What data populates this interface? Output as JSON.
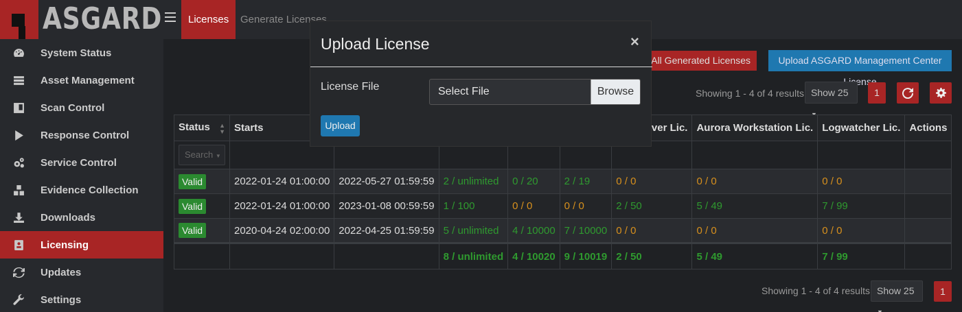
{
  "brand": {
    "name": "ASGARD"
  },
  "sidebar": {
    "items": [
      {
        "label": "System Status",
        "icon": "dashboard-icon"
      },
      {
        "label": "Asset Management",
        "icon": "server-icon"
      },
      {
        "label": "Scan Control",
        "icon": "scan-icon"
      },
      {
        "label": "Response Control",
        "icon": "play-icon"
      },
      {
        "label": "Service Control",
        "icon": "gears-icon"
      },
      {
        "label": "Evidence Collection",
        "icon": "cubes-icon"
      },
      {
        "label": "Downloads",
        "icon": "download-icon"
      },
      {
        "label": "Licensing",
        "icon": "id-card-icon",
        "active": true
      },
      {
        "label": "Updates",
        "icon": "refresh-icon"
      },
      {
        "label": "Settings",
        "icon": "wrench-icon"
      }
    ]
  },
  "topbar": {
    "tabs": [
      "Licenses",
      "Generate Licenses"
    ]
  },
  "toolbar": {
    "download_all": "ad All Generated Licenses",
    "upload_amc": "Upload ASGARD Management Center License",
    "showing": "Showing 1 - 4 of 4 results",
    "show_count": "Show 25",
    "page": "1"
  },
  "table": {
    "headers": [
      "Status",
      "Starts",
      "",
      "",
      "",
      "",
      "ora Server Lic.",
      "Aurora Workstation Lic.",
      "Logwatcher Lic.",
      "Actions"
    ],
    "search_placeholder": "Search",
    "rows": [
      {
        "status": "Valid",
        "starts": "2022-01-24 01:00:00",
        "expires": "2022-05-27 01:59:59",
        "c1": "2 / unlimited",
        "c2": "0 / 20",
        "c3": "2 / 19",
        "c4": "0 / 0",
        "c5": "0 / 0",
        "c6": "0 / 0"
      },
      {
        "status": "Valid",
        "starts": "2022-01-24 01:00:00",
        "expires": "2023-01-08 00:59:59",
        "c1": "1 / 100",
        "c2": "0 / 0",
        "c3": "0 / 0",
        "c4": "2 / 50",
        "c5": "5 / 49",
        "c6": "7 / 99"
      },
      {
        "status": "Valid",
        "starts": "2020-04-24 02:00:00",
        "expires": "2022-04-25 01:59:59",
        "c1": "5 / unlimited",
        "c2": "4 / 10000",
        "c3": "7 / 10000",
        "c4": "0 / 0",
        "c5": "0 / 0",
        "c6": "0 / 0"
      }
    ],
    "totals": {
      "c1": "8 / unlimited",
      "c2": "4 / 10020",
      "c3": "9 / 10019",
      "c4": "2 / 50",
      "c5": "5 / 49",
      "c6": "7 / 99"
    }
  },
  "footer": {
    "showing": "Showing 1 - 4 of 4 results",
    "show_count": "Show 25",
    "page": "1"
  },
  "modal": {
    "title": "Upload License",
    "close": "×",
    "field_label": "License File",
    "file_placeholder": "Select File",
    "browse": "Browse",
    "upload": "Upload"
  },
  "colors": {
    "accent_red": "#a82525",
    "accent_blue": "#1f78b0",
    "ok_green": "#2f9a2f",
    "warn_orange": "#d7901d"
  }
}
